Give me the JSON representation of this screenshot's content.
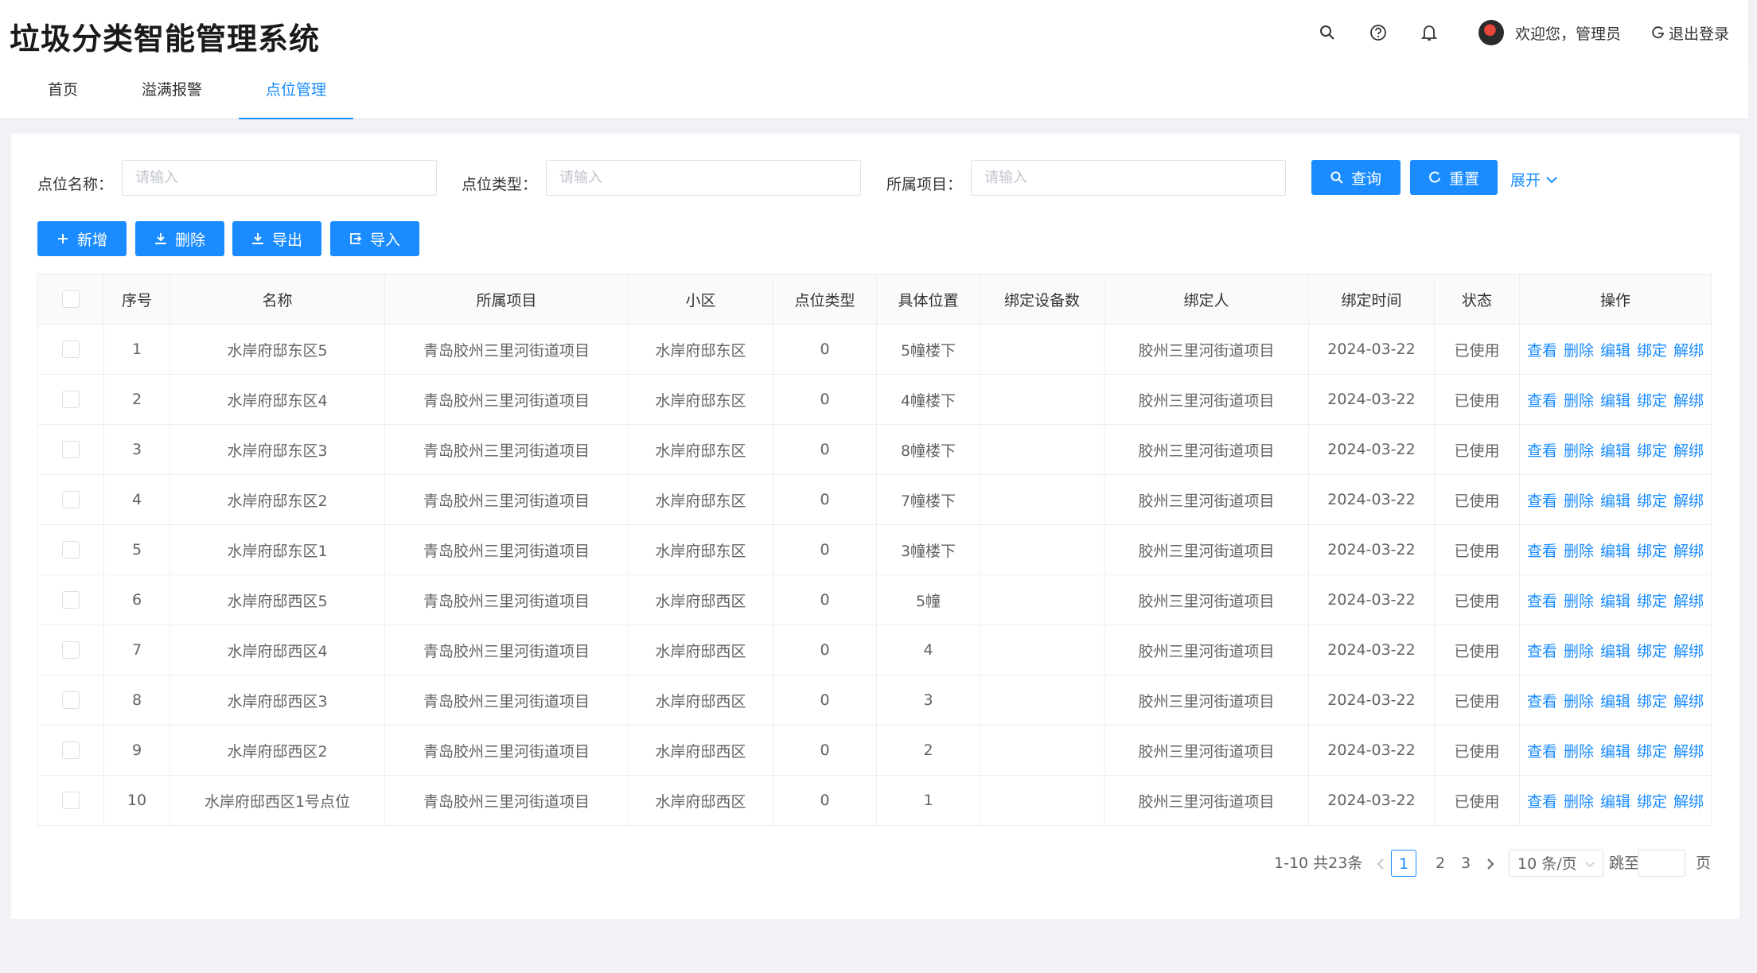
{
  "app": {
    "title": "垃圾分类智能管理系统"
  },
  "header": {
    "icons": [
      "search-icon",
      "help-icon",
      "bell-icon"
    ],
    "welcome": "欢迎您，管理员",
    "logout": "退出登录"
  },
  "tabs": [
    {
      "label": "首页",
      "active": false
    },
    {
      "label": "溢满报警",
      "active": false
    },
    {
      "label": "点位管理",
      "active": true
    }
  ],
  "filters": {
    "name_label": "点位名称：",
    "type_label": "点位类型：",
    "project_label": "所属项目：",
    "placeholder": "请输入",
    "search": "查询",
    "reset": "重置",
    "expand": "展开"
  },
  "actions": {
    "add": "新增",
    "delete": "删除",
    "export": "导出",
    "import": "导入"
  },
  "table": {
    "columns": [
      "序号",
      "名称",
      "所属项目",
      "小区",
      "点位类型",
      "具体位置",
      "绑定设备数",
      "绑定人",
      "绑定时间",
      "状态",
      "操作"
    ],
    "ops": [
      "查看",
      "删除",
      "编辑",
      "绑定",
      "解绑"
    ],
    "rows": [
      {
        "no": "1",
        "name": "水岸府邸东区5",
        "project": "青岛胶州三里河街道项目",
        "community": "水岸府邸东区",
        "type": "0",
        "location": "5幢楼下",
        "devices": "",
        "binder": "胶州三里河街道项目",
        "time": "2024-03-22",
        "status": "已使用"
      },
      {
        "no": "2",
        "name": "水岸府邸东区4",
        "project": "青岛胶州三里河街道项目",
        "community": "水岸府邸东区",
        "type": "0",
        "location": "4幢楼下",
        "devices": "",
        "binder": "胶州三里河街道项目",
        "time": "2024-03-22",
        "status": "已使用"
      },
      {
        "no": "3",
        "name": "水岸府邸东区3",
        "project": "青岛胶州三里河街道项目",
        "community": "水岸府邸东区",
        "type": "0",
        "location": "8幢楼下",
        "devices": "",
        "binder": "胶州三里河街道项目",
        "time": "2024-03-22",
        "status": "已使用"
      },
      {
        "no": "4",
        "name": "水岸府邸东区2",
        "project": "青岛胶州三里河街道项目",
        "community": "水岸府邸东区",
        "type": "0",
        "location": "7幢楼下",
        "devices": "",
        "binder": "胶州三里河街道项目",
        "time": "2024-03-22",
        "status": "已使用"
      },
      {
        "no": "5",
        "name": "水岸府邸东区1",
        "project": "青岛胶州三里河街道项目",
        "community": "水岸府邸东区",
        "type": "0",
        "location": "3幢楼下",
        "devices": "",
        "binder": "胶州三里河街道项目",
        "time": "2024-03-22",
        "status": "已使用"
      },
      {
        "no": "6",
        "name": "水岸府邸西区5",
        "project": "青岛胶州三里河街道项目",
        "community": "水岸府邸西区",
        "type": "0",
        "location": "5幢",
        "devices": "",
        "binder": "胶州三里河街道项目",
        "time": "2024-03-22",
        "status": "已使用"
      },
      {
        "no": "7",
        "name": "水岸府邸西区4",
        "project": "青岛胶州三里河街道项目",
        "community": "水岸府邸西区",
        "type": "0",
        "location": "4",
        "devices": "",
        "binder": "胶州三里河街道项目",
        "time": "2024-03-22",
        "status": "已使用"
      },
      {
        "no": "8",
        "name": "水岸府邸西区3",
        "project": "青岛胶州三里河街道项目",
        "community": "水岸府邸西区",
        "type": "0",
        "location": "3",
        "devices": "",
        "binder": "胶州三里河街道项目",
        "time": "2024-03-22",
        "status": "已使用"
      },
      {
        "no": "9",
        "name": "水岸府邸西区2",
        "project": "青岛胶州三里河街道项目",
        "community": "水岸府邸西区",
        "type": "0",
        "location": "2",
        "devices": "",
        "binder": "胶州三里河街道项目",
        "time": "2024-03-22",
        "status": "已使用"
      },
      {
        "no": "10",
        "name": "水岸府邸西区1号点位",
        "project": "青岛胶州三里河街道项目",
        "community": "水岸府邸西区",
        "type": "0",
        "location": "1",
        "devices": "",
        "binder": "胶州三里河街道项目",
        "time": "2024-03-22",
        "status": "已使用"
      }
    ]
  },
  "pagination": {
    "summary": "1-10 共23条",
    "pages": [
      "1",
      "2",
      "3"
    ],
    "current": "1",
    "page_size": "10 条/页",
    "jump_label": "跳至",
    "page_suffix": "页"
  },
  "colors": {
    "primary": "#1a8cff",
    "border": "#ebeef5",
    "header_bg": "#fafafa"
  }
}
